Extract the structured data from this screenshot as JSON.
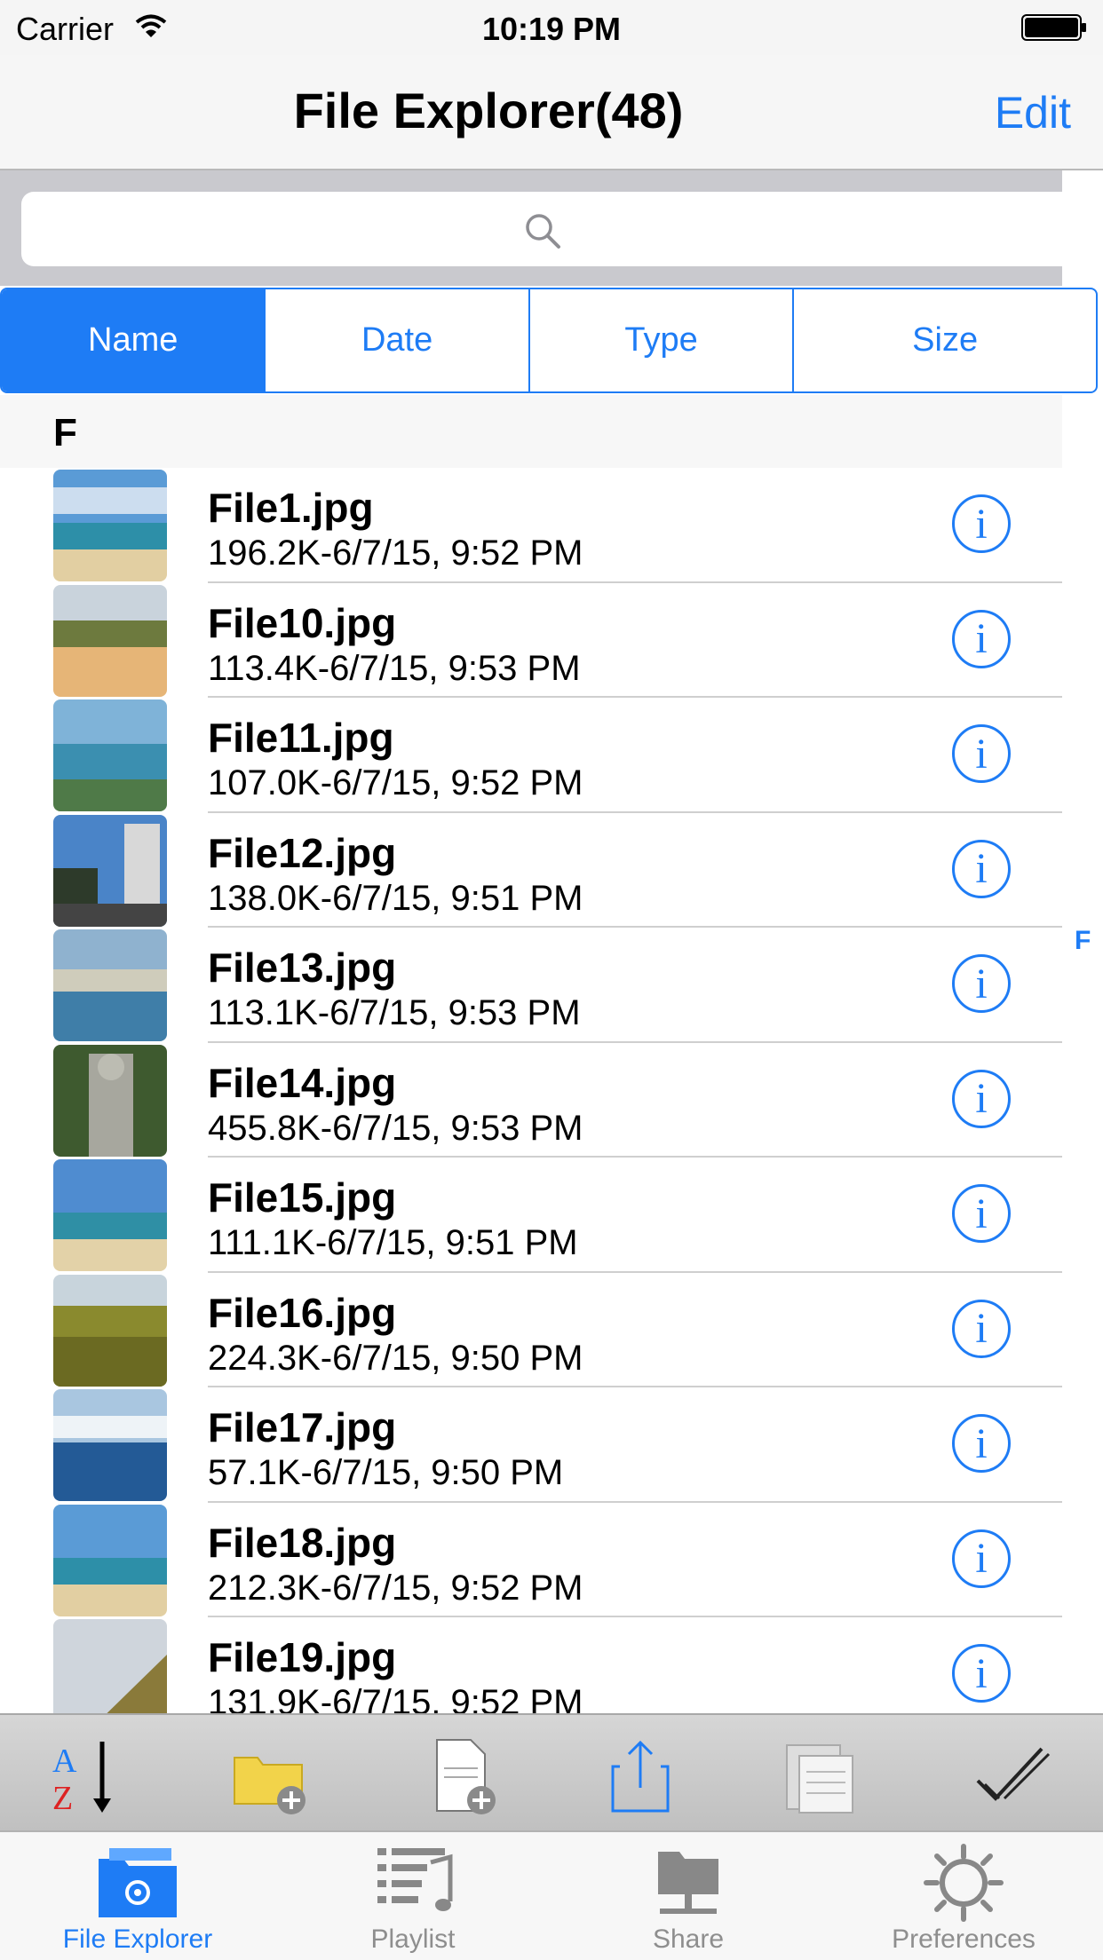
{
  "status_bar": {
    "carrier": "Carrier",
    "time": "10:19 PM"
  },
  "nav": {
    "title": "File Explorer(48)",
    "edit_label": "Edit"
  },
  "search": {
    "placeholder": ""
  },
  "segments": [
    {
      "label": "Name",
      "active": true
    },
    {
      "label": "Date",
      "active": false
    },
    {
      "label": "Type",
      "active": false
    },
    {
      "label": "Size",
      "active": false
    }
  ],
  "section": {
    "letter": "F"
  },
  "index": {
    "letter": "F"
  },
  "files": [
    {
      "name": "File1.jpg",
      "meta": "196.2K-6/7/15, 9:52 PM"
    },
    {
      "name": "File10.jpg",
      "meta": "113.4K-6/7/15, 9:53 PM"
    },
    {
      "name": "File11.jpg",
      "meta": "107.0K-6/7/15, 9:52 PM"
    },
    {
      "name": "File12.jpg",
      "meta": "138.0K-6/7/15, 9:51 PM"
    },
    {
      "name": "File13.jpg",
      "meta": "113.1K-6/7/15, 9:53 PM"
    },
    {
      "name": "File14.jpg",
      "meta": "455.8K-6/7/15, 9:53 PM"
    },
    {
      "name": "File15.jpg",
      "meta": "111.1K-6/7/15, 9:51 PM"
    },
    {
      "name": "File16.jpg",
      "meta": "224.3K-6/7/15, 9:50 PM"
    },
    {
      "name": "File17.jpg",
      "meta": "57.1K-6/7/15, 9:50 PM"
    },
    {
      "name": "File18.jpg",
      "meta": "212.3K-6/7/15, 9:52 PM"
    },
    {
      "name": "File19.jpg",
      "meta": "131.9K-6/7/15, 9:52 PM"
    }
  ],
  "info_glyph": "i",
  "tabs": [
    {
      "label": "File Explorer",
      "active": true
    },
    {
      "label": "Playlist",
      "active": false
    },
    {
      "label": "Share",
      "active": false
    },
    {
      "label": "Preferences",
      "active": false
    }
  ],
  "colors": {
    "accent": "#1e7cf5",
    "inactive": "#8e8e8e"
  }
}
